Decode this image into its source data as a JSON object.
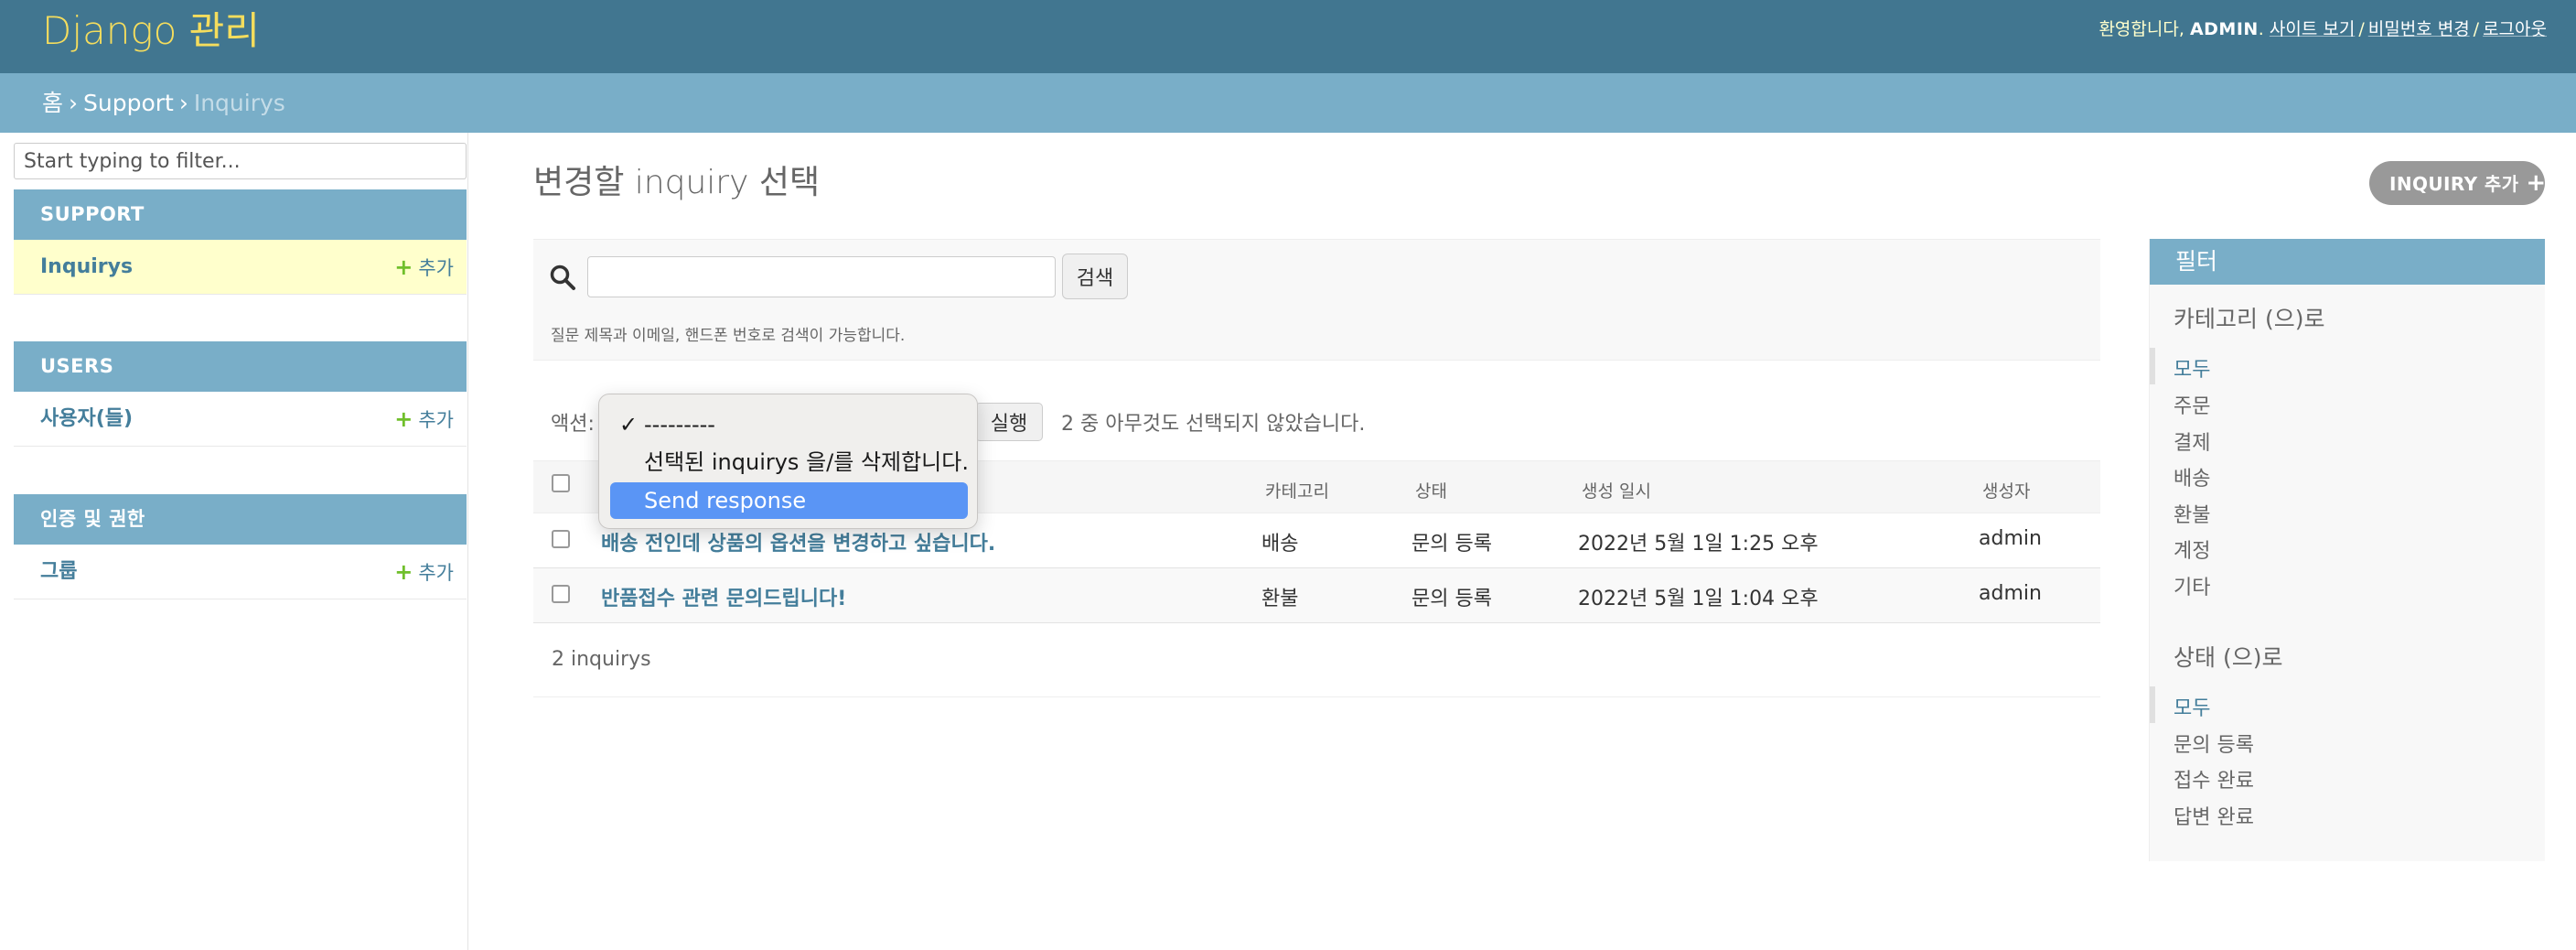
{
  "header": {
    "brand": "Django 관리",
    "welcome": "환영합니다, ",
    "username": "ADMIN",
    "period": ".",
    "links": [
      "사이트 보기",
      "비밀번호 변경",
      "로그아웃"
    ]
  },
  "breadcrumbs": {
    "home": "홈",
    "app": "Support",
    "current": "Inquirys",
    "separator": "›"
  },
  "sidebar": {
    "filter_placeholder": "Start typing to filter...",
    "modules": [
      {
        "caption": "SUPPORT",
        "items": [
          {
            "label": "Inquirys",
            "add": "추가"
          }
        ]
      },
      {
        "caption": "USERS",
        "items": [
          {
            "label": "사용자(들)",
            "add": "추가"
          }
        ]
      },
      {
        "caption": "인증 및 권한",
        "items": [
          {
            "label": "그룹",
            "add": "추가"
          }
        ]
      }
    ]
  },
  "main": {
    "title": "변경할 inquiry 선택",
    "add_button": "INQUIRY 추가",
    "search": {
      "button": "검색",
      "help": "질문 제목과 이메일, 핸드폰 번호로 검색이 가능합니다."
    },
    "actions": {
      "label": "액션:",
      "go": "실행",
      "counter": "2 중 아무것도 선택되지 않았습니다.",
      "options": [
        "---------",
        "선택된 inquirys 을/를 삭제합니다.",
        "Send response"
      ],
      "selected_index": 0,
      "highlighted_index": 2
    },
    "table": {
      "headers": [
        "카테고리",
        "상태",
        "생성 일시",
        "생성자"
      ],
      "rows": [
        {
          "title": "배송 전인데 상품의 옵션을 변경하고 싶습니다.",
          "category": "배송",
          "status": "문의 등록",
          "created": "2022년 5월 1일 1:25 오후",
          "author": "admin"
        },
        {
          "title": "반품접수 관련 문의드립니다!",
          "category": "환불",
          "status": "문의 등록",
          "created": "2022년 5월 1일 1:04 오후",
          "author": "admin"
        }
      ]
    },
    "paginator": "2 inquirys"
  },
  "filter": {
    "title": "필터",
    "sections": [
      {
        "title": "카테고리 (으)로",
        "items": [
          "모두",
          "주문",
          "결제",
          "배송",
          "환불",
          "계정",
          "기타"
        ],
        "selected": 0
      },
      {
        "title": "상태 (으)로",
        "items": [
          "모두",
          "문의 등록",
          "접수 완료",
          "답변 완료"
        ],
        "selected": 0
      }
    ]
  },
  "colors": {
    "header_bg": "#417690",
    "breadcrumb_bg": "#79aec8",
    "brand": "#f5dd5d",
    "link": "#447e9b",
    "add_green": "#70bf2b",
    "dropdown_highlight": "#5a95f5"
  }
}
